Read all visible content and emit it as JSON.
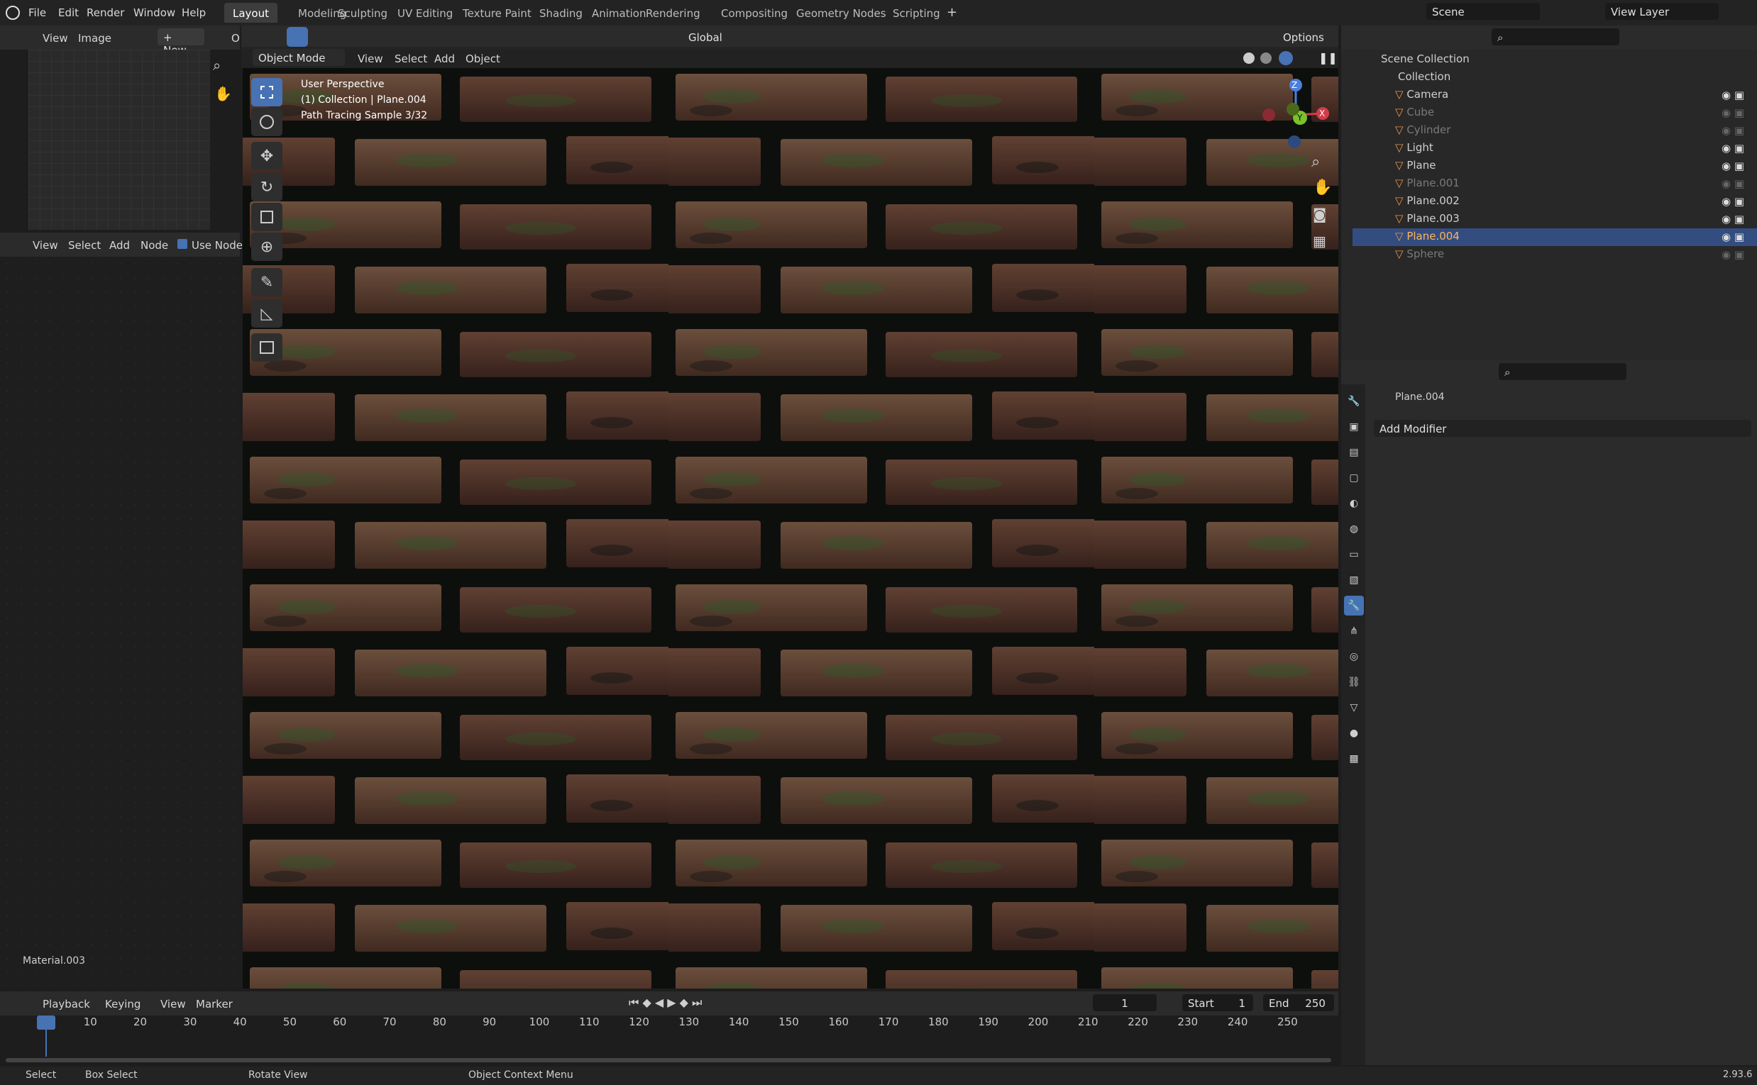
{
  "app": {
    "version": "2.93.6"
  },
  "menus": [
    "File",
    "Edit",
    "Render",
    "Window",
    "Help"
  ],
  "workspaces": [
    "Layout",
    "Modeling",
    "Sculpting",
    "UV Editing",
    "Texture Paint",
    "Shading",
    "Animation",
    "Rendering",
    "Compositing",
    "Geometry Nodes",
    "Scripting"
  ],
  "active_workspace": "Layout",
  "scene": {
    "name": "Scene",
    "view_layer": "View Layer"
  },
  "image_editor": {
    "view": "View",
    "image": "Image",
    "new": "New",
    "open_trunc": "O"
  },
  "node_editor": {
    "view": "View",
    "select": "Select",
    "add": "Add",
    "node": "Node",
    "use_nodes": "Use Nodes",
    "material": "Material.003"
  },
  "viewport": {
    "transform": "Global",
    "options": "Options",
    "mode": "Object Mode",
    "view": "View",
    "select": "Select",
    "add": "Add",
    "object": "Object",
    "overlay_lines": [
      "User Perspective",
      "(1) Collection | Plane.004",
      "Path Tracing Sample 3/32"
    ],
    "gizmo": {
      "z": "Z",
      "y": "Y",
      "x": "X"
    }
  },
  "outliner": {
    "root": "Scene Collection",
    "collection": "Collection",
    "items": [
      {
        "name": "Camera",
        "dim": false,
        "selected": false
      },
      {
        "name": "Cube",
        "dim": true,
        "selected": false
      },
      {
        "name": "Cylinder",
        "dim": true,
        "selected": false
      },
      {
        "name": "Light",
        "dim": false,
        "selected": false
      },
      {
        "name": "Plane",
        "dim": false,
        "selected": false
      },
      {
        "name": "Plane.001",
        "dim": true,
        "selected": false
      },
      {
        "name": "Plane.002",
        "dim": false,
        "selected": false
      },
      {
        "name": "Plane.003",
        "dim": false,
        "selected": false
      },
      {
        "name": "Plane.004",
        "dim": false,
        "selected": true
      },
      {
        "name": "Sphere",
        "dim": true,
        "selected": false
      }
    ]
  },
  "properties": {
    "object": "Plane.004",
    "add_modifier": "Add Modifier"
  },
  "timeline": {
    "playback": "Playback",
    "keying": "Keying",
    "view": "View",
    "marker": "Marker",
    "current_frame": "1",
    "start_label": "Start",
    "start": "1",
    "end_label": "End",
    "end": "250",
    "ticks": [
      "1",
      "10",
      "20",
      "30",
      "40",
      "50",
      "60",
      "70",
      "80",
      "90",
      "100",
      "110",
      "120",
      "130",
      "140",
      "150",
      "160",
      "170",
      "180",
      "190",
      "200",
      "210",
      "220",
      "230",
      "240",
      "250"
    ]
  },
  "statusbar": {
    "select": "Select",
    "box_select": "Box Select",
    "rotate": "Rotate View",
    "context": "Object Context Menu"
  },
  "colors": {
    "accent": "#4772b3",
    "selected_row": "#334d80",
    "header": "#2b2b2b",
    "background": "#1d1d1d"
  }
}
